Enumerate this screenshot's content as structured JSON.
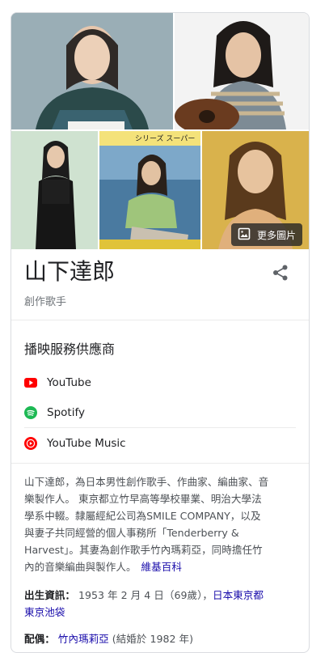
{
  "gallery": {
    "more_images_label": "更多圖片",
    "strip_text": "シリーズ スーパー"
  },
  "entity": {
    "name": "山下達郎",
    "type": "創作歌手"
  },
  "streaming": {
    "heading": "播映服務供應商",
    "providers": [
      {
        "label": "YouTube",
        "icon": "youtube-icon",
        "color": "#ff0000"
      },
      {
        "label": "Spotify",
        "icon": "spotify-icon",
        "color": "#1db954"
      },
      {
        "label": "YouTube Music",
        "icon": "youtube-music-icon",
        "color": "#ff0000"
      }
    ]
  },
  "description": {
    "lines": [
      "山下達郎，為日本男性創作歌手、作曲家、編曲家、音",
      "樂製作人。 東京都立竹早高等學校畢業、明治大學法",
      "學系中輟。隸屬經紀公司為SMILE COMPANY，以及",
      "與妻子共同經營的個人事務所「Tenderberry &",
      "Harvest」。其妻為創作歌手竹內瑪莉亞，同時擔任竹",
      "內的音樂編曲與製作人。"
    ],
    "source_link": "維基百科"
  },
  "facts": {
    "born_label": "出生資訊：",
    "born_value": "1953 年 2 月 4 日（69歲）",
    "born_place_1": "日本東京都",
    "born_place_2": "東京池袋",
    "spouse_label": "配偶：",
    "spouse_name": "竹內瑪莉亞",
    "spouse_detail": "(結婚於 1982 年)"
  }
}
